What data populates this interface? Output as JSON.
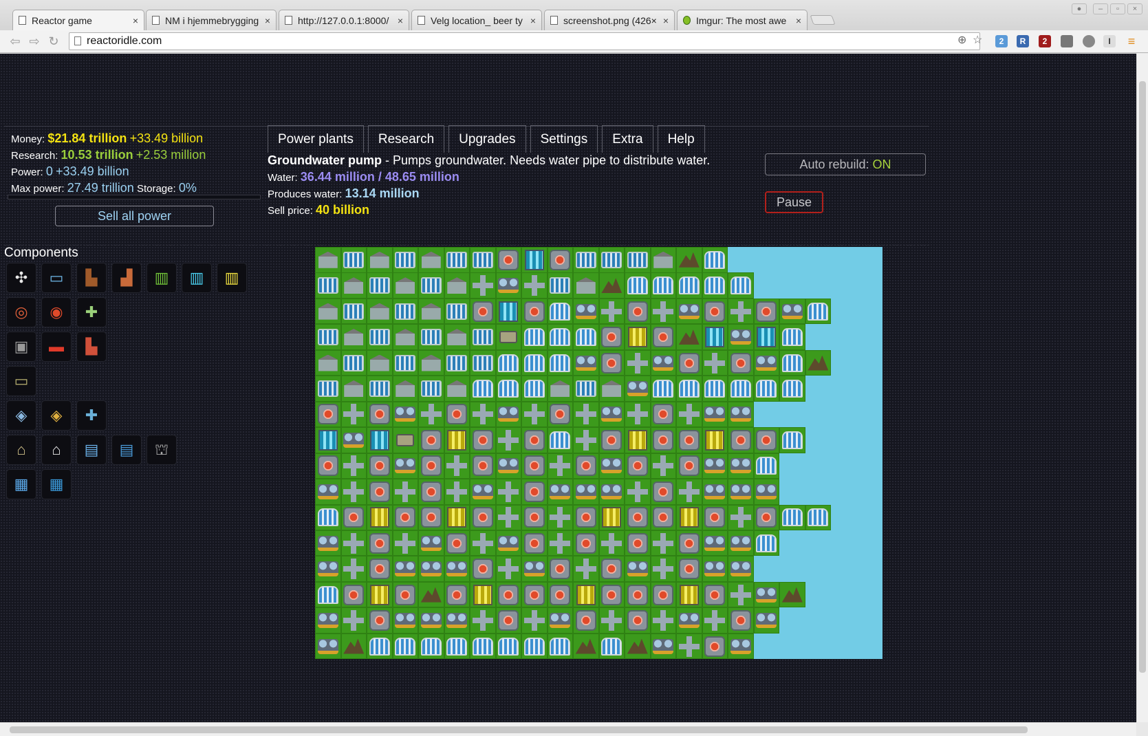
{
  "browser": {
    "tabs": [
      {
        "label": "Reactor game",
        "active": true
      },
      {
        "label": "NM i hjemmebrygging",
        "active": false
      },
      {
        "label": "http://127.0.0.1:8000/",
        "active": false
      },
      {
        "label": "Velg location_ beer ty",
        "active": false
      },
      {
        "label": "screenshot.png (426×",
        "active": false
      },
      {
        "label": "Imgur: The most awe",
        "active": false
      }
    ],
    "close_glyph": "×",
    "url": "reactoridle.com",
    "extensions": {
      "ghostery_badge": "2",
      "r_label": "R",
      "ublock_badge": "2",
      "i_label": "I"
    }
  },
  "stats": {
    "money_label": "Money:",
    "money_value": "$21.84 trillion",
    "money_rate": "+33.49 billion",
    "research_label": "Research:",
    "research_value": "10.53 trillion",
    "research_rate": "+2.53 million",
    "power_label": "Power:",
    "power_value": "0",
    "power_rate": "+33.49 billion",
    "maxpower_label": "Max power:",
    "maxpower_value": "27.49 trillion",
    "storage_label": "Storage:",
    "storage_value": "0%",
    "storage_fraction": 0.0
  },
  "buttons": {
    "sell_all": "Sell all power",
    "auto_rebuild_label": "Auto rebuild:",
    "auto_rebuild_state": "ON",
    "pause": "Pause"
  },
  "nav": {
    "tabs": [
      "Power plants",
      "Research",
      "Upgrades",
      "Settings",
      "Extra",
      "Help"
    ]
  },
  "info": {
    "name": "Groundwater pump",
    "description": " - Pumps groundwater. Needs water pipe to distribute water.",
    "water_label": "Water:",
    "water_value": "36.44 million / 48.65 million",
    "produces_label": "Produces water:",
    "produces_value": "13.14 million",
    "sell_label": "Sell price:",
    "sell_value": "40 billion"
  },
  "components": {
    "title": "Components",
    "items": [
      {
        "name": "wind-turbine",
        "glyph": "✣",
        "color": "#e8e8e8"
      },
      {
        "name": "solar-panel",
        "glyph": "▭",
        "color": "#6fb8e8"
      },
      {
        "name": "coal-burner",
        "glyph": "▙",
        "color": "#a05a2a"
      },
      {
        "name": "gas-burner",
        "glyph": "▟",
        "color": "#c86a3a"
      },
      {
        "name": "cell-green",
        "glyph": "▥",
        "color": "#74c83a"
      },
      {
        "name": "cell-cyan",
        "glyph": "▥",
        "color": "#4ad0f0"
      },
      {
        "name": "cell-yellow",
        "glyph": "▥",
        "color": "#f0e040"
      },
      {
        "name": "heat-exchanger",
        "glyph": "◎",
        "color": "#e0603a"
      },
      {
        "name": "generator",
        "glyph": "◉",
        "color": "#e04a2a"
      },
      {
        "name": "heat-pipe",
        "glyph": "✚",
        "color": "#9ad07a"
      },
      {
        "name": "storage-box",
        "glyph": "▣",
        "color": "#9a9a9a"
      },
      {
        "name": "battery-red",
        "glyph": "▬",
        "color": "#e03a2a"
      },
      {
        "name": "heat-vent",
        "glyph": "▙",
        "color": "#d0503a"
      },
      {
        "name": "battery",
        "glyph": "▭",
        "color": "#b8b070"
      },
      {
        "name": "water-pump",
        "glyph": "◈",
        "color": "#8ab8e0"
      },
      {
        "name": "groundwater-pump",
        "glyph": "◈",
        "color": "#e0b040"
      },
      {
        "name": "water-pipe",
        "glyph": "✚",
        "color": "#6ab0d8"
      },
      {
        "name": "house-small",
        "glyph": "⌂",
        "color": "#d0c08a"
      },
      {
        "name": "house-large",
        "glyph": "⌂",
        "color": "#e8e8e8"
      },
      {
        "name": "office",
        "glyph": "▤",
        "color": "#6ab0e8"
      },
      {
        "name": "factory",
        "glyph": "▤",
        "color": "#4a9ad8"
      },
      {
        "name": "bank",
        "glyph": "⛫",
        "color": "#a8a8a8"
      },
      {
        "name": "skyscraper",
        "glyph": "▦",
        "color": "#5aa8e8"
      },
      {
        "name": "plant-building",
        "glyph": "▦",
        "color": "#3a98d8"
      }
    ]
  },
  "grid": {
    "rows": [
      "hohohoogcgoOohmF~~~~~~~~~~~",
      "OhOhohpPpOhmFFFFF~~~~~~~~~~",
      "hohohogcgFPpgpPgpgPF~~~~~~~",
      "OhOhohObFFFgygmcPcF~~~~~~~~",
      "hohohoOFFFPgpPgpgPFm~~~~~~~",
      "OhOhohFFFhOhPFFFFFF~~~~~~~~",
      "gpgPpgpPpgpPpgpPP~~~~~~~~~~",
      "cPcbgygpgFpgyggyggF~~~~~~~~",
      "gpgPgpgPgpgPgpgPPF~~~~~~~~~",
      "PpgpgpPpgPPPpgpPPP~~~~~~~~~",
      "FgyggygpgpgyggygpgFF~~~~~~~",
      "PpgpPgpPgpgpgpgPPF~~~~~~~~~",
      "PpgPPPgpPgpgPpgPP~~~~~~~~~~",
      "FgygmgygggygggygpPm~~~~~~~~",
      "PpgPPPpgpPgpgpPpgP~~~~~~~~~",
      "PmFFFFFFFFmFmPpgP~~~~~~~~~~"
    ],
    "legend": {
      "h": "house",
      "o": "office",
      "O": "house-blue",
      "F": "factory",
      "g": "generator",
      "p": "pipe",
      "P": "water-pump",
      "c": "cell-cyan",
      "y": "cell-yellow",
      "b": "battery",
      "m": "mountain",
      "~": "sea"
    }
  }
}
